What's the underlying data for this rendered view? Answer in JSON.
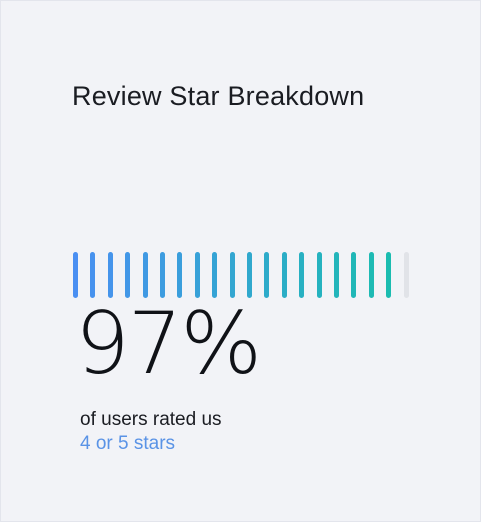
{
  "card": {
    "title": "Review Star Breakdown",
    "percent_text": "97%",
    "caption": "of users rated us",
    "highlight": "4 or 5 stars"
  },
  "meter": {
    "total_ticks": 20,
    "filled_ticks": 19,
    "value_fraction": 0.97,
    "color_start": "#4a8ff2",
    "color_end": "#1bbcb0",
    "color_empty": "#e1e3e8"
  },
  "colors": {
    "background": "#f2f3f7",
    "text": "#1a1c22",
    "accent": "#5a93e6"
  }
}
